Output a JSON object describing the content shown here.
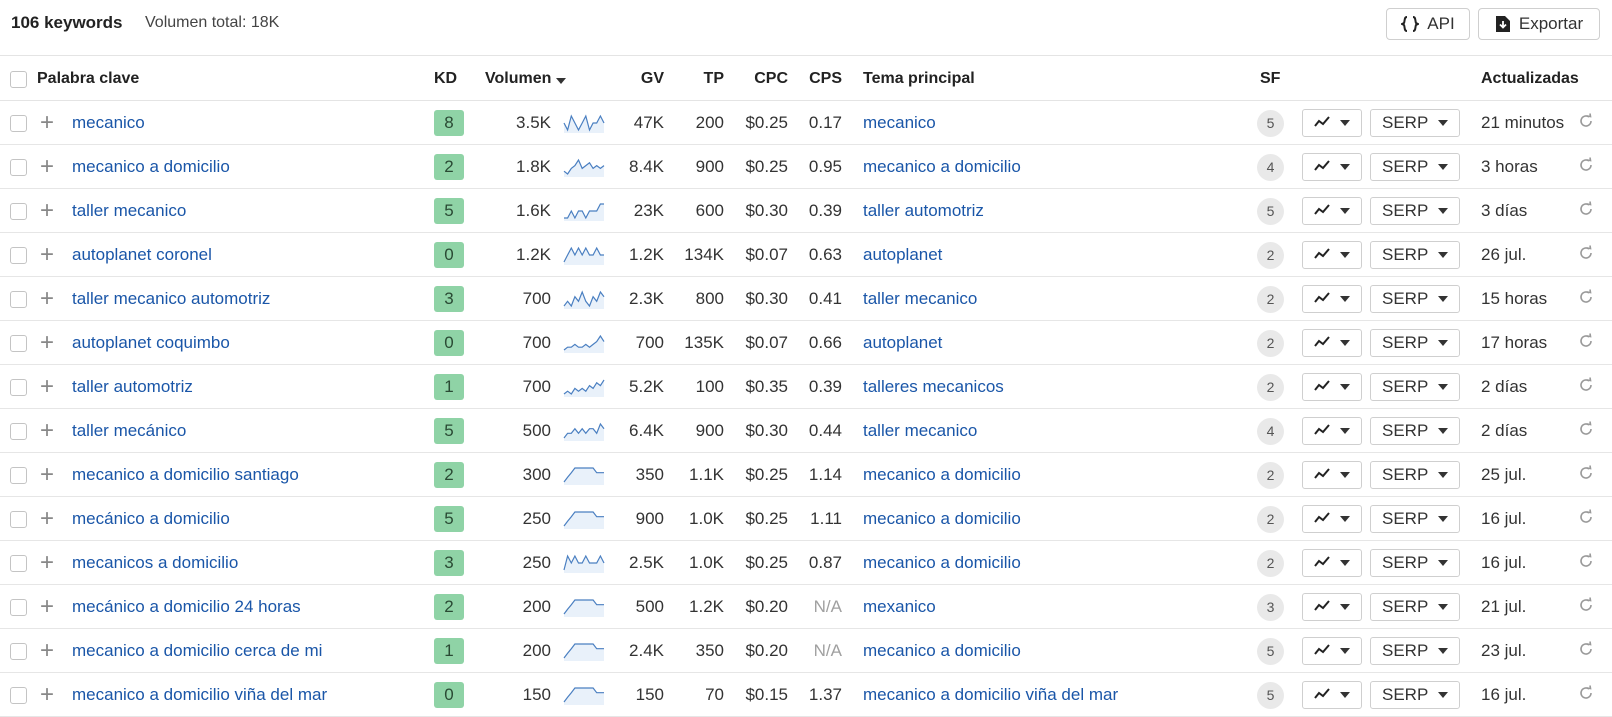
{
  "header": {
    "keywords_count": "106 keywords",
    "volume_total": "Volumen total: 18K",
    "api_label": "API",
    "export_label": "Exportar"
  },
  "columns": {
    "keyword": "Palabra clave",
    "kd": "KD",
    "volume": "Volumen",
    "gv": "GV",
    "tp": "TP",
    "cpc": "CPC",
    "cps": "CPS",
    "parent_topic": "Tema principal",
    "sf": "SF",
    "updated": "Actualizadas"
  },
  "serp_label": "SERP",
  "colors": {
    "link": "#1a56a8",
    "kd_easy": "#8fd3a6",
    "sparkline": "#4a7fc1"
  },
  "rows": [
    {
      "keyword": "mecanico",
      "kd": "8",
      "volume": "3.5K",
      "gv": "47K",
      "tp": "200",
      "cpc": "$0.25",
      "cps": "0.17",
      "topic": "mecanico",
      "sf": "5",
      "updated": "21 minutos",
      "trend": [
        5,
        4,
        6,
        5,
        4,
        5,
        6,
        4,
        5,
        5,
        6,
        5
      ]
    },
    {
      "keyword": "mecanico a domicilio",
      "kd": "2",
      "volume": "1.8K",
      "gv": "8.4K",
      "tp": "900",
      "cpc": "$0.25",
      "cps": "0.95",
      "topic": "mecanico a domicilio",
      "sf": "4",
      "updated": "3 horas",
      "trend": [
        4,
        3,
        5,
        6,
        8,
        5,
        6,
        7,
        5,
        6,
        5,
        6
      ]
    },
    {
      "keyword": "taller mecanico",
      "kd": "5",
      "volume": "1.6K",
      "gv": "23K",
      "tp": "600",
      "cpc": "$0.30",
      "cps": "0.39",
      "topic": "taller automotriz",
      "sf": "5",
      "updated": "3 días",
      "trend": [
        6,
        6,
        7,
        6,
        7,
        7,
        6,
        7,
        7,
        7,
        8,
        8
      ]
    },
    {
      "keyword": "autoplanet coronel",
      "kd": "0",
      "volume": "1.2K",
      "gv": "1.2K",
      "tp": "134K",
      "cpc": "$0.07",
      "cps": "0.63",
      "topic": "autoplanet",
      "sf": "2",
      "updated": "26 jul.",
      "trend": [
        5,
        6,
        7,
        6,
        7,
        6,
        7,
        6,
        6,
        7,
        6,
        6
      ]
    },
    {
      "keyword": "taller mecanico automotriz",
      "kd": "3",
      "volume": "700",
      "gv": "2.3K",
      "tp": "800",
      "cpc": "$0.30",
      "cps": "0.41",
      "topic": "taller mecanico",
      "sf": "2",
      "updated": "15 horas",
      "trend": [
        4,
        5,
        4,
        6,
        5,
        7,
        5,
        4,
        6,
        5,
        7,
        6
      ]
    },
    {
      "keyword": "autoplanet coquimbo",
      "kd": "0",
      "volume": "700",
      "gv": "700",
      "tp": "135K",
      "cpc": "$0.07",
      "cps": "0.66",
      "topic": "autoplanet",
      "sf": "2",
      "updated": "17 horas",
      "trend": [
        3,
        4,
        4,
        5,
        4,
        4,
        5,
        4,
        5,
        6,
        8,
        6
      ]
    },
    {
      "keyword": "taller automotriz",
      "kd": "1",
      "volume": "700",
      "gv": "5.2K",
      "tp": "100",
      "cpc": "$0.35",
      "cps": "0.39",
      "topic": "talleres mecanicos",
      "sf": "2",
      "updated": "2 días",
      "trend": [
        3,
        4,
        3,
        5,
        4,
        5,
        4,
        6,
        5,
        7,
        6,
        8
      ]
    },
    {
      "keyword": "taller mecánico",
      "kd": "5",
      "volume": "500",
      "gv": "6.4K",
      "tp": "900",
      "cpc": "$0.30",
      "cps": "0.44",
      "topic": "taller mecanico",
      "sf": "4",
      "updated": "2 días",
      "trend": [
        4,
        5,
        5,
        6,
        5,
        6,
        5,
        6,
        6,
        5,
        7,
        6
      ]
    },
    {
      "keyword": "mecanico a domicilio santiago",
      "kd": "2",
      "volume": "300",
      "gv": "350",
      "tp": "1.1K",
      "cpc": "$0.25",
      "cps": "1.14",
      "topic": "mecanico a domicilio",
      "sf": "2",
      "updated": "25 jul.",
      "trend": [
        3,
        4,
        5,
        6,
        6,
        6,
        6,
        6,
        6,
        5,
        5,
        5
      ]
    },
    {
      "keyword": "mecánico a domicilio",
      "kd": "5",
      "volume": "250",
      "gv": "900",
      "tp": "1.0K",
      "cpc": "$0.25",
      "cps": "1.11",
      "topic": "mecanico a domicilio",
      "sf": "2",
      "updated": "16 jul.",
      "trend": [
        3,
        4,
        5,
        6,
        6,
        6,
        6,
        6,
        6,
        5,
        5,
        5
      ]
    },
    {
      "keyword": "mecanicos a domicilio",
      "kd": "3",
      "volume": "250",
      "gv": "2.5K",
      "tp": "1.0K",
      "cpc": "$0.25",
      "cps": "0.87",
      "topic": "mecanico a domicilio",
      "sf": "2",
      "updated": "16 jul.",
      "trend": [
        5,
        7,
        6,
        7,
        6,
        6,
        7,
        6,
        6,
        6,
        7,
        6
      ]
    },
    {
      "keyword": "mecánico a domicilio 24 horas",
      "kd": "2",
      "volume": "200",
      "gv": "500",
      "tp": "1.2K",
      "cpc": "$0.20",
      "cps": "N/A",
      "topic": "mexanico",
      "sf": "3",
      "updated": "21 jul.",
      "trend": [
        3,
        4,
        5,
        6,
        6,
        6,
        6,
        6,
        6,
        5,
        5,
        5
      ]
    },
    {
      "keyword": "mecanico a domicilio cerca de mi",
      "kd": "1",
      "volume": "200",
      "gv": "2.4K",
      "tp": "350",
      "cpc": "$0.20",
      "cps": "N/A",
      "topic": "mecanico a domicilio",
      "sf": "5",
      "updated": "23 jul.",
      "trend": [
        3,
        4,
        5,
        6,
        6,
        6,
        6,
        6,
        6,
        5,
        5,
        5
      ]
    },
    {
      "keyword": "mecanico a domicilio viña del mar",
      "kd": "0",
      "volume": "150",
      "gv": "150",
      "tp": "70",
      "cpc": "$0.15",
      "cps": "1.37",
      "topic": "mecanico a domicilio viña del mar",
      "sf": "5",
      "updated": "16 jul.",
      "trend": [
        3,
        4,
        5,
        6,
        6,
        6,
        6,
        6,
        6,
        5,
        5,
        5
      ]
    }
  ]
}
